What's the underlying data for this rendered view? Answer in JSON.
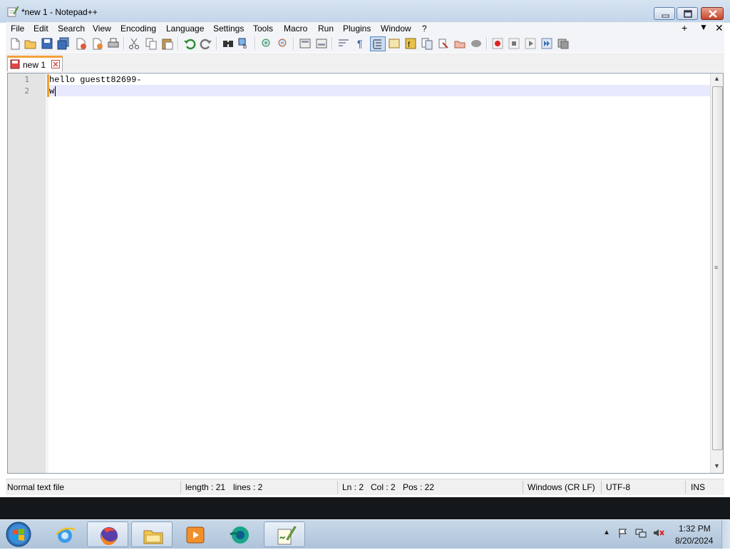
{
  "window": {
    "title": "*new 1 - Notepad++",
    "app_icon": "notepad-plus-plus-icon"
  },
  "menu": {
    "items": [
      "File",
      "Edit",
      "Search",
      "View",
      "Encoding",
      "Language",
      "Settings",
      "Tools",
      "Macro",
      "Run",
      "Plugins",
      "Window",
      "?"
    ],
    "right": {
      "plus": "+",
      "down": "▼",
      "close": "✕"
    }
  },
  "toolbar": {
    "icons": [
      "new-file-icon",
      "open-file-icon",
      "save-icon",
      "save-all-icon",
      "close-icon",
      "close-all-icon",
      "print-icon",
      "cut-icon",
      "copy-icon",
      "paste-icon",
      "undo-icon",
      "redo-icon",
      "find-icon",
      "replace-icon",
      "zoom-in-icon",
      "zoom-out-icon",
      "sync-vertical-icon",
      "sync-horizontal-icon",
      "word-wrap-icon",
      "show-all-chars-icon",
      "indent-guide-icon",
      "udl-icon",
      "function-list-icon",
      "doc-map-icon",
      "folder-as-workspace-icon",
      "doc-list-icon",
      "monitoring-icon",
      "record-macro-icon",
      "stop-record-icon",
      "play-macro-icon",
      "run-macro-multiple-icon",
      "save-macro-icon"
    ]
  },
  "tabs": [
    {
      "label": "new 1",
      "modified": true
    }
  ],
  "editor": {
    "line_numbers": [
      "1",
      "2"
    ],
    "lines": [
      "hello guestt82699-",
      "w"
    ],
    "current_line": 2
  },
  "status": {
    "file_type": "Normal text file",
    "length": "length : 21",
    "lines": "lines : 2",
    "ln": "Ln : 2",
    "col": "Col : 2",
    "pos": "Pos : 22",
    "eol": "Windows (CR LF)",
    "encoding": "UTF-8",
    "mode": "INS"
  },
  "taskbar": {
    "items": [
      {
        "name": "internet-explorer-icon",
        "state": "pinned"
      },
      {
        "name": "firefox-icon",
        "state": "open"
      },
      {
        "name": "file-explorer-icon",
        "state": "open"
      },
      {
        "name": "media-player-icon",
        "state": "pinned"
      },
      {
        "name": "green-app-icon",
        "state": "pinned"
      },
      {
        "name": "notepad-plus-plus-icon",
        "state": "open"
      }
    ],
    "tray_icons": [
      "show-hidden-icons",
      "flag-icon",
      "network-icon",
      "volume-muted-icon"
    ],
    "clock": {
      "time": "1:32 PM",
      "date": "8/20/2024"
    }
  },
  "colors": {
    "modified_tab_accent": "#f5a23a",
    "current_line_highlight": "#e8e8ff",
    "gutter": "#e4e4e4"
  }
}
